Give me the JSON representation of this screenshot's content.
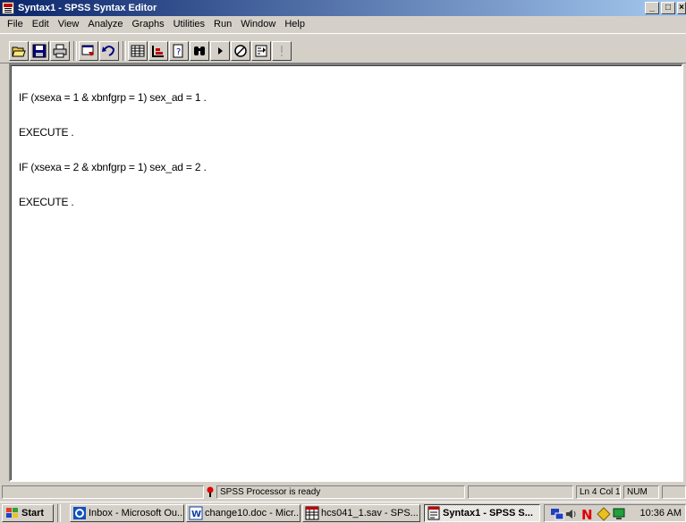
{
  "window": {
    "title": "Syntax1 - SPSS Syntax Editor",
    "caption_buttons": [
      "_",
      "□",
      "×"
    ]
  },
  "menu": [
    "File",
    "Edit",
    "View",
    "Analyze",
    "Graphs",
    "Utilities",
    "Run",
    "Window",
    "Help"
  ],
  "toolbar": {
    "buttons": [
      {
        "icon": "open-folder-icon"
      },
      {
        "icon": "save-disk-icon"
      },
      {
        "icon": "printer-icon"
      },
      {
        "icon": "dialog-recall-icon"
      },
      {
        "icon": "undo-icon"
      },
      {
        "icon": "goto-data-icon"
      },
      {
        "icon": "variables-icon"
      },
      {
        "icon": "syntax-help-icon"
      },
      {
        "icon": "find-binoculars-icon"
      },
      {
        "icon": "run-current-icon"
      },
      {
        "icon": "stop-processor-icon"
      },
      {
        "icon": "value-labels-icon"
      },
      {
        "icon": "run-exclamation-icon"
      }
    ]
  },
  "editor": {
    "lines": [
      "IF (xsexa = 1 & xbnfgrp = 1) sex_ad = 1 .",
      "EXECUTE .",
      "IF (xsexa = 2 & xbnfgrp = 1) sex_ad = 2 .",
      "EXECUTE ."
    ]
  },
  "status": {
    "processor": "SPSS Processor  is ready",
    "position": "Ln 4 Col 1",
    "num": "NUM"
  },
  "taskbar": {
    "start_label": "Start",
    "tasks": [
      {
        "label": "Inbox - Microsoft Ou...",
        "icon": "outlook-icon",
        "active": false
      },
      {
        "label": "change10.doc - Micr...",
        "icon": "word-icon",
        "active": false
      },
      {
        "label": "hcs041_1.sav - SPS...",
        "icon": "spss-data-icon",
        "active": false
      },
      {
        "label": "Syntax1 - SPSS S...",
        "icon": "spss-syntax-icon",
        "active": true
      }
    ],
    "clock": "10:36 AM"
  },
  "colors": {
    "title_active_start": "#0a246a",
    "title_active_end": "#a6caf0",
    "face": "#d4d0c8"
  }
}
